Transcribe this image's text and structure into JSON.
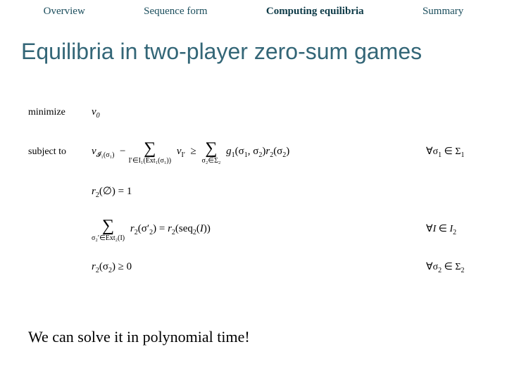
{
  "nav": {
    "items": [
      {
        "label": "Overview",
        "active": false
      },
      {
        "label": "Sequence form",
        "active": false
      },
      {
        "label": "Computing equilibria",
        "active": true
      },
      {
        "label": "Summary",
        "active": false
      }
    ]
  },
  "title": "Equilibria in two-player zero-sum games",
  "lp": {
    "objective_label": "minimize",
    "objective_expr": "v₀",
    "subject_label": "subject to",
    "constraints": [
      {
        "lhs_a": "v_{I₁(σ₁)} −",
        "sum1_sub": "I′∈I₁(Ext₁(σ₁))",
        "mid": "v_{I′} ≥",
        "sum2_sub": "σ₂∈Σ₂",
        "rhs": "g₁(σ₁, σ₂) r₂(σ₂)",
        "qual": "∀σ₁ ∈ Σ₁"
      },
      {
        "expr": "r₂(∅) = 1",
        "qual": ""
      },
      {
        "sum_sub": "σ₂′∈Ext₂(I)",
        "expr": "r₂(σ₂′) = r₂(seq₂(I))",
        "qual": "∀I ∈ I₂"
      },
      {
        "expr": "r₂(σ₂) ≥ 0",
        "qual": "∀σ₂ ∈ Σ₂"
      }
    ]
  },
  "conclusion": "We can solve it in polynomial time!"
}
